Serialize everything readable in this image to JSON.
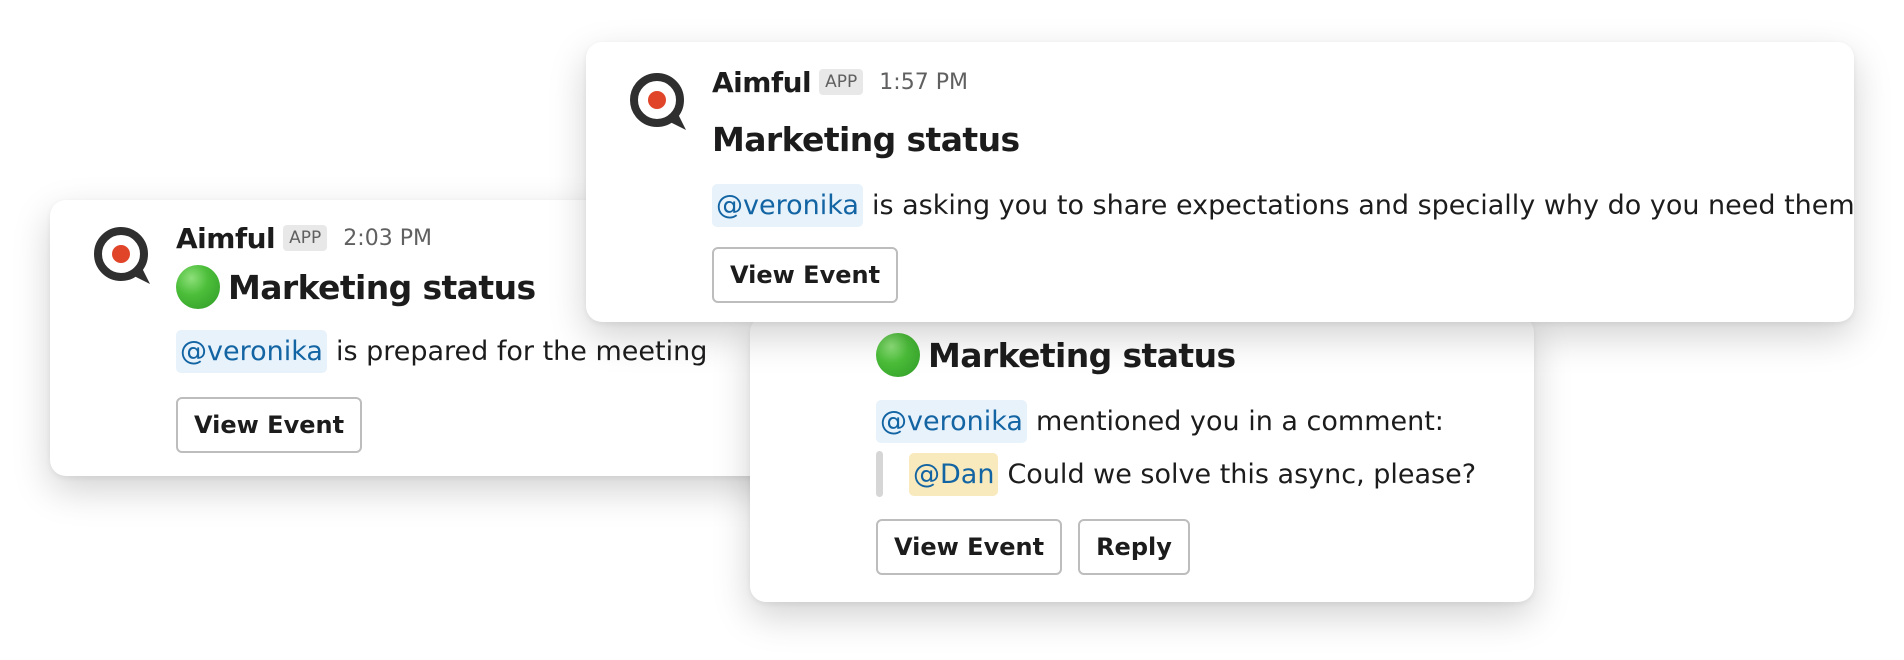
{
  "colors": {
    "mention_text": "#1264a3",
    "mention_bg": "#e8f2fb",
    "mention_highlight_bg": "#f8eabc",
    "logo_dark": "#2f2f2f",
    "logo_accent": "#e0452a",
    "status_green": "#4cbe3a"
  },
  "cards": {
    "top": {
      "app_name": "Aimful",
      "badge": "APP",
      "time": "1:57 PM",
      "title": "Marketing status",
      "mention": "@veronika",
      "message": "is asking you to share expectations and specially why do you need them",
      "button": "View Event",
      "icon": "aimful-logo-icon"
    },
    "left": {
      "app_name": "Aimful",
      "badge": "APP",
      "time": "2:03 PM",
      "title": "Marketing status",
      "status_icon": "green-circle-icon",
      "mention": "@veronika",
      "message": "is prepared for the meeting",
      "button": "View Event",
      "icon": "aimful-logo-icon"
    },
    "mid": {
      "title": "Marketing status",
      "status_icon": "green-circle-icon",
      "mention": "@veronika",
      "message": "mentioned you in a comment:",
      "quote_mention": "@Dan",
      "quote_text": "Could we solve this async, please?",
      "button_primary": "View Event",
      "button_secondary": "Reply"
    }
  }
}
